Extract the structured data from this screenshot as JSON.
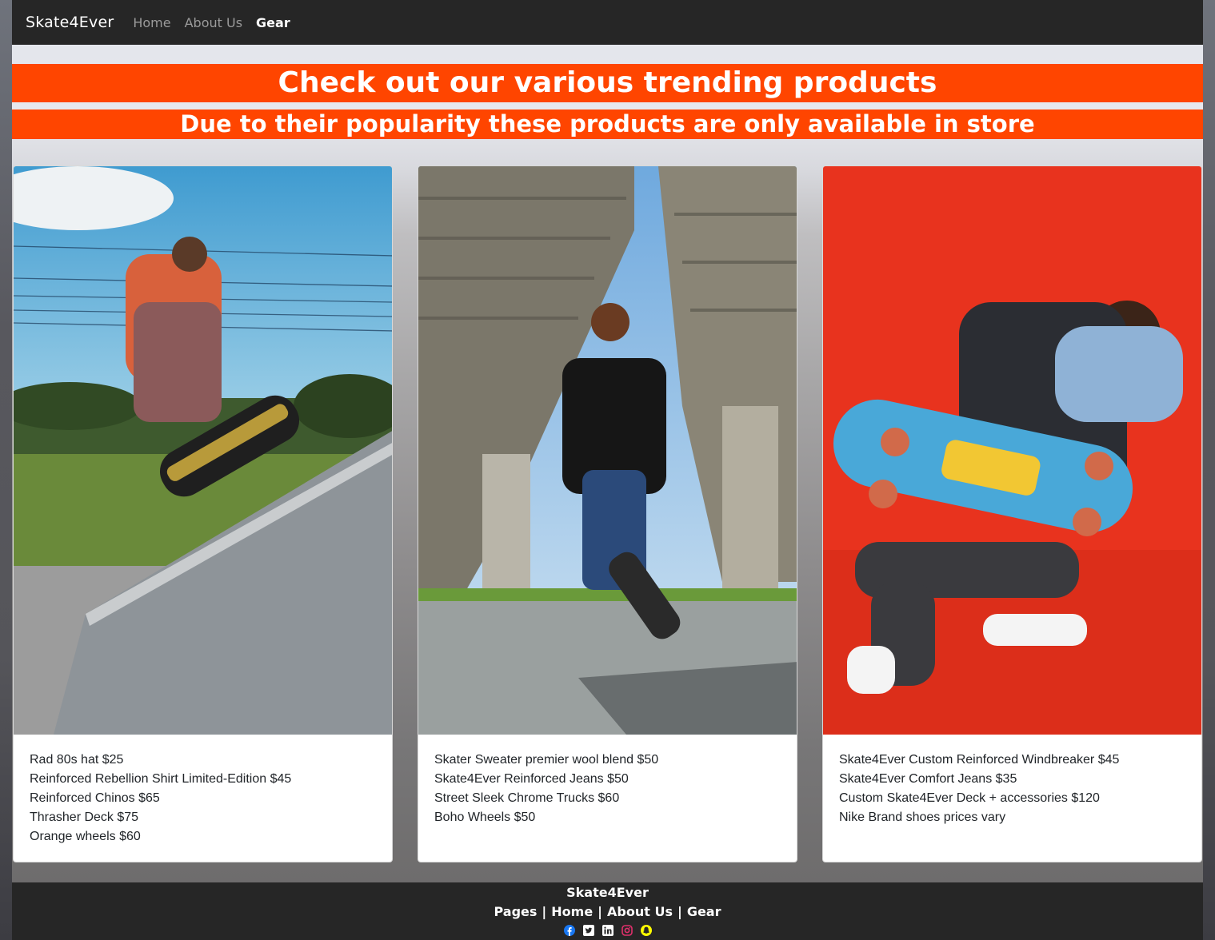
{
  "nav": {
    "brand": "Skate4Ever",
    "links": [
      {
        "label": "Home"
      },
      {
        "label": "About Us"
      },
      {
        "label": "Gear"
      }
    ]
  },
  "headings": {
    "title": "Check out our various trending products",
    "subtitle": "Due to their popularity these products are only available in store"
  },
  "cards": [
    {
      "image": "skater-jumping-photo",
      "items": [
        "Rad 80s hat $25",
        "Reinforced Rebellion Shirt Limited-Edition $45",
        "Reinforced Chinos $65",
        "Thrasher Deck $75",
        "Orange wheels $60"
      ]
    },
    {
      "image": "skater-under-bridge-photo",
      "items": [
        "Skater Sweater premier wool blend $50",
        "Skate4Ever Reinforced Jeans $50",
        "Street Sleek Chrome Trucks $60",
        "Boho Wheels $50"
      ]
    },
    {
      "image": "man-holding-skateboard-photo",
      "items": [
        "Skate4Ever Custom Reinforced Windbreaker $45",
        "Skate4Ever Comfort Jeans $35",
        "Custom Skate4Ever Deck + accessories $120",
        "Nike Brand shoes prices vary"
      ]
    }
  ],
  "footer": {
    "brand": "Skate4Ever",
    "links": [
      "Pages",
      "Home",
      "About Us",
      "Gear"
    ],
    "separator": "|",
    "social": [
      {
        "icon": "facebook-icon",
        "color": "#1877f2"
      },
      {
        "icon": "twitter-icon",
        "color": "#ffffff"
      },
      {
        "icon": "linkedin-icon",
        "color": "#ffffff"
      },
      {
        "icon": "instagram-icon",
        "color": "#e1306c"
      },
      {
        "icon": "snapchat-icon",
        "color": "#fffc00"
      }
    ]
  },
  "colors": {
    "navbar": "#262626",
    "banner": "#ff4500",
    "card_bg": "#ffffff",
    "text": "#212529"
  }
}
